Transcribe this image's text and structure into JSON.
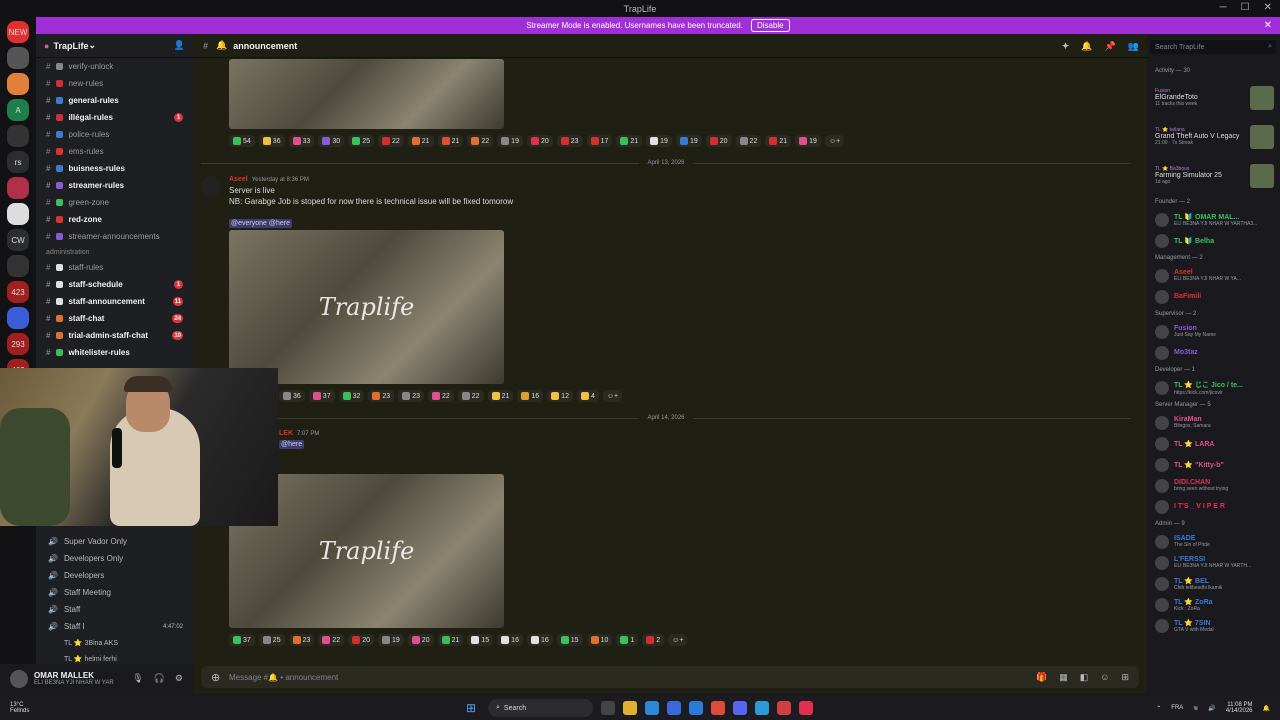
{
  "window": {
    "title": "TrapLife"
  },
  "banner": {
    "text": "Streamer Mode is enabled. Usernames have been truncated.",
    "button": "Disable"
  },
  "servers": [
    {
      "label": "NEW",
      "color": "#e03030"
    },
    {
      "label": "",
      "color": "#555"
    },
    {
      "label": "",
      "color": "#e0803a"
    },
    {
      "label": "A",
      "color": "#1e7f4a"
    },
    {
      "label": "",
      "color": "#333"
    },
    {
      "label": "rs",
      "color": "#2b2d31"
    },
    {
      "label": "",
      "color": "#b0304a"
    },
    {
      "label": "",
      "color": "#ddd"
    },
    {
      "label": "CW",
      "color": "#2b2d31"
    },
    {
      "label": "",
      "color": "#333"
    },
    {
      "label": "423",
      "color": "#a02020"
    },
    {
      "label": "",
      "color": "#3b5dd8"
    },
    {
      "label": "293",
      "color": "#a02020"
    },
    {
      "label": "462",
      "color": "#a02020"
    }
  ],
  "guild": {
    "name": "TrapLife",
    "chevron": "⌄"
  },
  "channels_top": [
    {
      "name": "verify-unlock",
      "bold": false,
      "emoji": "#888"
    },
    {
      "name": "new-rules",
      "bold": false,
      "emoji": "#d03030"
    },
    {
      "name": "general-rules",
      "bold": true,
      "emoji": "#3a7bd5"
    },
    {
      "name": "illégal-rules",
      "bold": true,
      "emoji": "#d03030",
      "badge": "1"
    },
    {
      "name": "police-rules",
      "bold": false,
      "emoji": "#3a7bd5"
    },
    {
      "name": "ems-rules",
      "bold": false,
      "emoji": "#e03030"
    },
    {
      "name": "buisness-rules",
      "bold": true,
      "emoji": "#3a7bd5"
    },
    {
      "name": "streamer-rules",
      "bold": true,
      "emoji": "#8a5ad8"
    },
    {
      "name": "green-zone",
      "bold": false,
      "emoji": "#3ac05a"
    },
    {
      "name": "red-zone",
      "bold": true,
      "emoji": "#e03030"
    },
    {
      "name": "streamer-announcements",
      "bold": false,
      "emoji": "#8a5ad8"
    }
  ],
  "admin_category": "administration",
  "channels_admin": [
    {
      "name": "staff-rules",
      "bold": false,
      "emoji": "#e0e0e0"
    },
    {
      "name": "staff-schedule",
      "bold": true,
      "emoji": "#e0e0e0",
      "badge": "1"
    },
    {
      "name": "staff-announcement",
      "bold": true,
      "emoji": "#e0e0e0",
      "badge": "11"
    },
    {
      "name": "staff-chat",
      "bold": true,
      "emoji": "#e07030",
      "badge": "24"
    },
    {
      "name": "trial-admin-staff-chat",
      "bold": true,
      "emoji": "#e07030",
      "badge": "10"
    },
    {
      "name": "whitelister-rules",
      "bold": true,
      "emoji": "#3ac05a"
    }
  ],
  "voice": [
    {
      "name": "Super Vador Only"
    },
    {
      "name": "Developers Only"
    },
    {
      "name": "Developers"
    },
    {
      "name": "Staff Meeting"
    },
    {
      "name": "Staff"
    },
    {
      "name": "Staff I",
      "time": "4:47:02"
    }
  ],
  "voice_users": [
    "TL ⭐ 3Bina AKS",
    "TL ⭐ helmi ferhi"
  ],
  "user": {
    "name": "OMAR MALLEK",
    "status": "ELI BE3NA YJI NHAR W YAR"
  },
  "channel": {
    "name": "announcement"
  },
  "messages": {
    "reacts1": [
      {
        "emoji": "#3ac05a",
        "count": "54"
      },
      {
        "emoji": "#f0c040",
        "count": "36"
      },
      {
        "emoji": "#e05090",
        "count": "33"
      },
      {
        "emoji": "#8a5ad8",
        "count": "30"
      },
      {
        "emoji": "#3ac05a",
        "count": "25"
      },
      {
        "emoji": "#d03030",
        "count": "22"
      },
      {
        "emoji": "#e07030",
        "count": "21"
      },
      {
        "emoji": "#e05030",
        "count": "21"
      },
      {
        "emoji": "#e07030",
        "count": "22"
      },
      {
        "emoji": "#888",
        "count": "19"
      },
      {
        "emoji": "#e03050",
        "count": "20"
      },
      {
        "emoji": "#d03030",
        "count": "23"
      },
      {
        "emoji": "#d03030",
        "count": "17"
      },
      {
        "emoji": "#3ac05a",
        "count": "21"
      },
      {
        "emoji": "#e0e0e0",
        "count": "19"
      },
      {
        "emoji": "#3a7bd5",
        "count": "19"
      },
      {
        "emoji": "#d03030",
        "count": "20"
      },
      {
        "emoji": "#888",
        "count": "22"
      },
      {
        "emoji": "#d03030",
        "count": "21"
      },
      {
        "emoji": "#e05090",
        "count": "19"
      }
    ],
    "date1": "April 13, 2026",
    "author1": "Aseel",
    "time1": "Yesterday at 8:36 PM",
    "line1": "Server is live",
    "line2": "NB: Garabge Job is stoped for now there is technical issue will be fixed tomorow",
    "mention1": "@everyone @here",
    "logo": "Traplife",
    "reacts2": [
      {
        "emoji": "#888",
        "count": "36"
      },
      {
        "emoji": "#e05090",
        "count": "37"
      },
      {
        "emoji": "#3ac05a",
        "count": "32"
      },
      {
        "emoji": "#e07030",
        "count": "23"
      },
      {
        "emoji": "#888",
        "count": "23"
      },
      {
        "emoji": "#e05090",
        "count": "22"
      },
      {
        "emoji": "#888",
        "count": "22"
      },
      {
        "emoji": "#f0c040",
        "count": "21"
      },
      {
        "emoji": "#e0a030",
        "count": "16"
      },
      {
        "emoji": "#f0c040",
        "count": "12"
      },
      {
        "emoji": "#f0c040",
        "count": "4"
      }
    ],
    "date2": "April 14, 2026",
    "author2": "LEK",
    "time2": "7:07 PM",
    "mention2": "@here",
    "reacts3": [
      {
        "emoji": "#3ac05a",
        "count": "37"
      },
      {
        "emoji": "#888",
        "count": "25"
      },
      {
        "emoji": "#e07030",
        "count": "23"
      },
      {
        "emoji": "#e05090",
        "count": "22"
      },
      {
        "emoji": "#d03030",
        "count": "20"
      },
      {
        "emoji": "#888",
        "count": "19"
      },
      {
        "emoji": "#e05090",
        "count": "20"
      },
      {
        "emoji": "#3ac05a",
        "count": "21"
      },
      {
        "emoji": "#e0e0e0",
        "count": "15"
      },
      {
        "emoji": "#e0e0e0",
        "count": "16"
      },
      {
        "emoji": "#e0e0e0",
        "count": "16"
      },
      {
        "emoji": "#3ac05a",
        "count": "15"
      },
      {
        "emoji": "#e07030",
        "count": "10"
      },
      {
        "emoji": "#3ac05a",
        "count": "1"
      },
      {
        "emoji": "#d03030",
        "count": "2"
      }
    ]
  },
  "composer": {
    "placeholder": "Message #🔔 • announcement"
  },
  "search": {
    "placeholder": "Search TrapLife"
  },
  "members": {
    "activity": "Activity — 30",
    "activities": [
      {
        "name": "ElGrandeToto",
        "user": "Fusion",
        "sub": "11 tracks this week"
      },
      {
        "name": "Grand Theft Auto V Legacy",
        "user": "TL ⭐ tatiana",
        "sub": "21:00 · 7x Streak"
      },
      {
        "name": "Farming Simulator 25",
        "user": "TL ⭐ Ba3bous",
        "sub": "1d ago"
      }
    ],
    "groups": [
      {
        "title": "Founder — 2",
        "items": [
          {
            "name": "TL 🔰 OMAR MAL...",
            "color": "#3ac05a",
            "sub": "ELI BE3NA YJI NHAR W YARTHA3..."
          },
          {
            "name": "TL 🔰 Belha",
            "color": "#3ac05a",
            "sub": ""
          }
        ]
      },
      {
        "title": "Management — 2",
        "items": [
          {
            "name": "Aseel",
            "color": "#e03030",
            "sub": "ELI BE3NA YJI NHAR W YA..."
          },
          {
            "name": "BaFimili",
            "color": "#e03030",
            "sub": ""
          }
        ]
      },
      {
        "title": "Supervisor — 2",
        "items": [
          {
            "name": "Fusion",
            "color": "#8a5ad8",
            "sub": "Just Say My Name"
          },
          {
            "name": "Mo3taz",
            "color": "#8a5ad8",
            "sub": ""
          }
        ]
      },
      {
        "title": "Developer — 1",
        "items": [
          {
            "name": "TL ⭐ じこ Jico / te...",
            "color": "#3ac05a",
            "sub": "https://kick.com/jicovlr"
          }
        ]
      },
      {
        "title": "Server Manager — 5",
        "items": [
          {
            "name": "KiraMan",
            "color": "#e05090",
            "sub": "Blingos, Samara"
          },
          {
            "name": "TL ⭐ LARA",
            "color": "#e05090",
            "sub": ""
          },
          {
            "name": "TL ⭐ \"Kitty-b\"",
            "color": "#e05090",
            "sub": ""
          },
          {
            "name": "DIDI.CHAN",
            "color": "#e03050",
            "sub": "bring seen without trying"
          },
          {
            "name": "I T'S _ V I P E R",
            "color": "#e03050",
            "sub": ""
          }
        ]
      },
      {
        "title": "Admin — 9",
        "items": [
          {
            "name": "ISADE",
            "color": "#3a7bd5",
            "sub": "The Sin of Pride"
          },
          {
            "name": "L'FERSSI",
            "color": "#3a7bd5",
            "sub": "ELI BE3NA YJI NHAR W YARTH..."
          },
          {
            "name": "TL ⭐ BEL",
            "color": "#3a7bd5",
            "sub": "Chib telibesdhi lkamik"
          },
          {
            "name": "TL ⭐ ZoRa",
            "color": "#3a7bd5",
            "sub": "Kick : ZoRa"
          },
          {
            "name": "TL ⭐ 7SIN",
            "color": "#3a7bd5",
            "sub": "GTA V with Medal"
          }
        ]
      }
    ]
  },
  "taskbar": {
    "weather_temp": "13°C",
    "weather_desc": "Fellnds",
    "search": "Search",
    "lang": "FRA",
    "time": "11:08 PM",
    "date": "4/14/2026"
  }
}
